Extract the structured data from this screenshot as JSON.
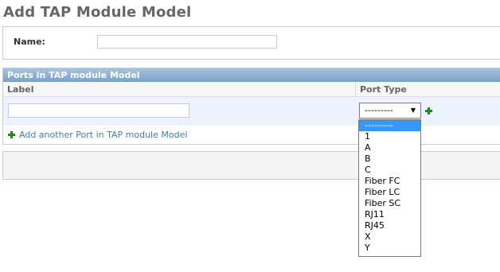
{
  "page": {
    "title": "Add TAP Module Model"
  },
  "name_field": {
    "label": "Name:",
    "value": ""
  },
  "inline_group": {
    "header": "Ports in TAP module Model",
    "columns": [
      "Label",
      "Port Type"
    ],
    "row": {
      "label_value": "",
      "port_type_selected": "---------"
    },
    "add_another_label": "Add another Port in TAP module Model"
  },
  "dropdown": {
    "options": [
      "---------",
      "1",
      "A",
      "B",
      "C",
      "Fiber FC",
      "Fiber LC",
      "Fiber SC",
      "RJ11",
      "RJ45",
      "X",
      "Y"
    ],
    "highlighted_index": 0
  },
  "icons": {
    "add": "plus-icon",
    "select_arrow": "chevron-down-icon"
  },
  "colors": {
    "header_bar": "#7aa1c6",
    "row_background": "#edf3fe",
    "link": "#447e9b",
    "add_icon": "#2ea12e",
    "highlight": "#3399ff"
  }
}
